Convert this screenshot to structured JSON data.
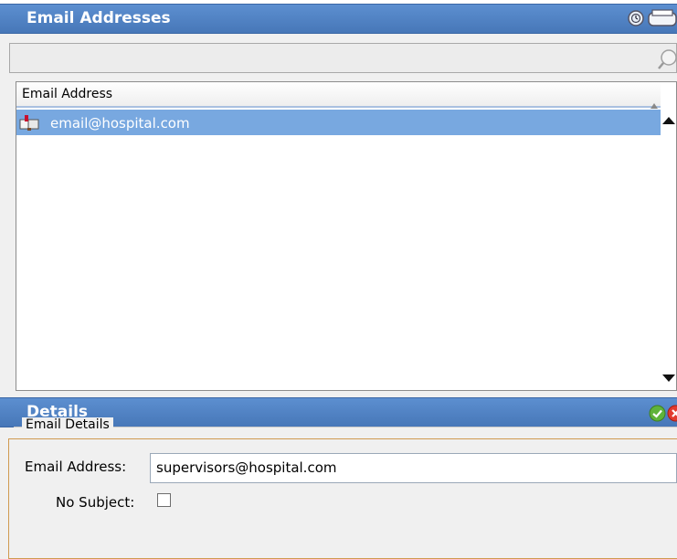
{
  "email_panel": {
    "title": "Email Addresses",
    "icons": [
      "clock-icon",
      "print-icon"
    ]
  },
  "search": {
    "value": "",
    "icon": "search-icon"
  },
  "grid": {
    "column_header": "Email Address",
    "rows": [
      {
        "icon": "mailbox-icon",
        "text": "email@hospital.com",
        "selected": true
      }
    ]
  },
  "details_panel": {
    "title": "Details",
    "icons": [
      "check-icon",
      "close-icon"
    ],
    "group_label": "Email Details",
    "email_label": "Email Address:",
    "email_value": "supervisors@hospital.com",
    "no_subject_label": "No Subject:",
    "no_subject_checked": false
  },
  "colors": {
    "header_blue": "#4f82c4",
    "selection_blue": "#78a8e0",
    "accent_orange": "#d09a50"
  }
}
